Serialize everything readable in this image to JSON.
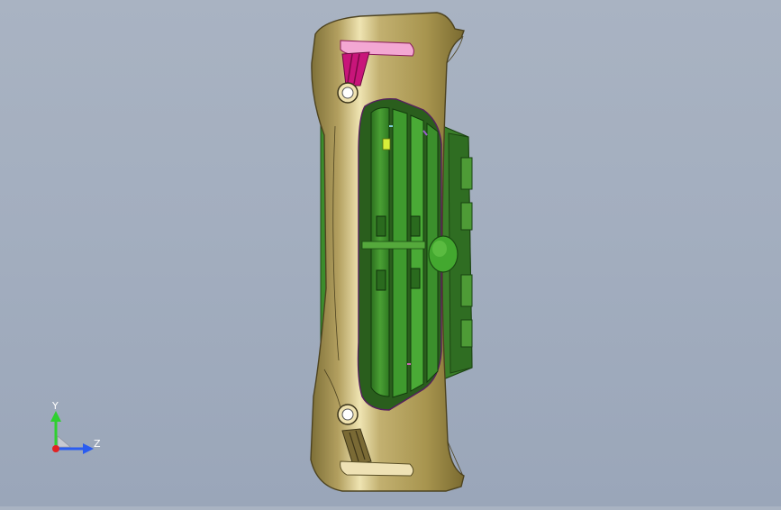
{
  "viewport": {
    "model": {
      "parts": [
        "bumper-body",
        "grille-insert",
        "grille-slats",
        "emblem-mount",
        "upper-fog-lamp-mount",
        "lower-fog-lamp-mount"
      ],
      "colors": {
        "bumper": "#b9a765",
        "bumper_dark": "#6f6230",
        "bumper_highlight": "#efe4b2",
        "grille": "#3c8c2c",
        "grille_dark": "#1f4f16",
        "grille_light": "#6fc04a",
        "magenta": "#c8157a",
        "pink": "#f3a7d3"
      }
    },
    "triad": {
      "y_label": "Y",
      "z_label": "Z",
      "colors": {
        "y": "#2fd02f",
        "z": "#2a5cf0",
        "x": "#e22222"
      }
    }
  }
}
